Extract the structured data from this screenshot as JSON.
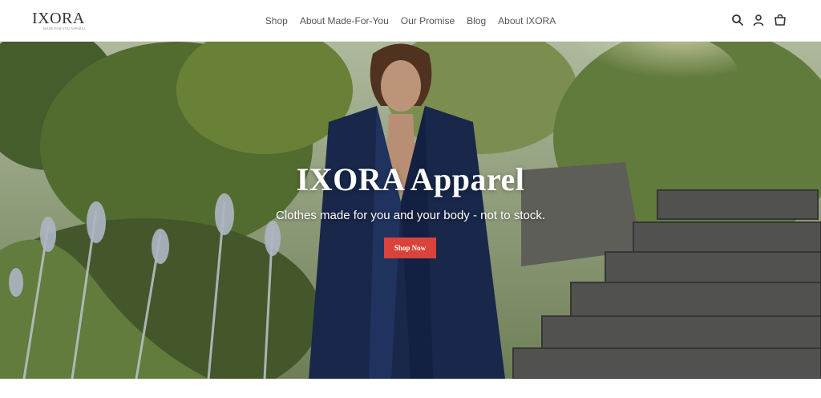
{
  "brand": {
    "logo_text": "IXORA",
    "logo_tagline": "MADE-FOR-YOU APPAREL"
  },
  "nav": {
    "items": [
      {
        "label": "Shop"
      },
      {
        "label": "About Made-For-You"
      },
      {
        "label": "Our Promise"
      },
      {
        "label": "Blog"
      },
      {
        "label": "About IXORA"
      }
    ]
  },
  "header_icons": [
    "search-icon",
    "account-icon",
    "cart-icon"
  ],
  "hero": {
    "title": "IXORA Apparel",
    "subtitle": "Clothes made for you and your body - not to stock.",
    "button_label": "Shop Now"
  },
  "colors": {
    "accent": "#d9433b",
    "nav_text": "#555555",
    "header_bg": "#ffffff"
  }
}
